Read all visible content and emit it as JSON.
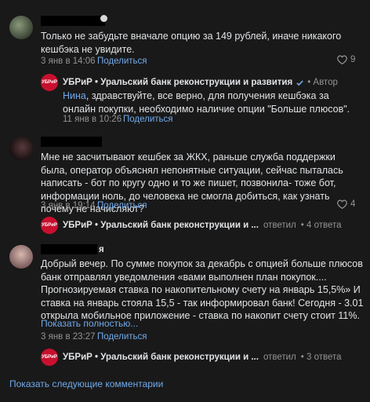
{
  "comments": [
    {
      "text": "Только не забудьте вначале опцию за 149 рублей, иначе никакого кешбэка не увидите.",
      "time": "3 янв в 14:06",
      "share": "Поделиться",
      "likes": "9"
    },
    {
      "text": "Мне не засчитывают кешбек за ЖКХ, раньше служба поддержки была, оператор объяснял непонятные ситуации, сейчас пыталась написать - бот по кругу одно и то же пишет, позвонила- тоже бот, информации ноль, до человека не смогла добиться, как узнать почему не начисляют?",
      "time": "3 янв в 19:14",
      "share": "Поделиться",
      "likes": "4"
    },
    {
      "name_suffix": "я",
      "text": "Добрый вечер. По сумме покупок за декабрь с опцией больше плюсов банк отправлял уведомления «вами выполнен план покупок.... Прогнозируемая ставка по накопительному счету на январь 15,5%» И ставка на январь стояла 15,5 - так информировал банк! Сегодня - 3.01 открыла мобильное приложение - ставка по накопит счету стоит 11%.",
      "show_more": "Показать полностью...",
      "time": "3 янв в 23:27",
      "share": "Поделиться"
    }
  ],
  "reply": {
    "logo_text": "УБРиР",
    "author": "УБРиР • Уральский банк реконструкции и развития",
    "author_badge": "• Автор",
    "addressee": "Нина",
    "text": ", здравствуйте, все верно, для получения кешбэка за онлайн покупки, необходимо наличие опции \"Больше плюсов\".",
    "time": "11 янв в 10:26",
    "share": "Поделиться"
  },
  "thread_summaries": [
    {
      "author": "УБРиР • Уральский банк реконструкции и ...",
      "action": "ответил",
      "count": "• 4 ответа"
    },
    {
      "author": "УБРиР • Уральский банк реконструкции и ...",
      "action": "ответил",
      "count": "• 3 ответа"
    }
  ],
  "show_next": "Показать следующие комментарии",
  "colors": {
    "background": "#191919",
    "link": "#71aaeb",
    "brand": "#c8102e",
    "verified": "#71aaeb"
  }
}
